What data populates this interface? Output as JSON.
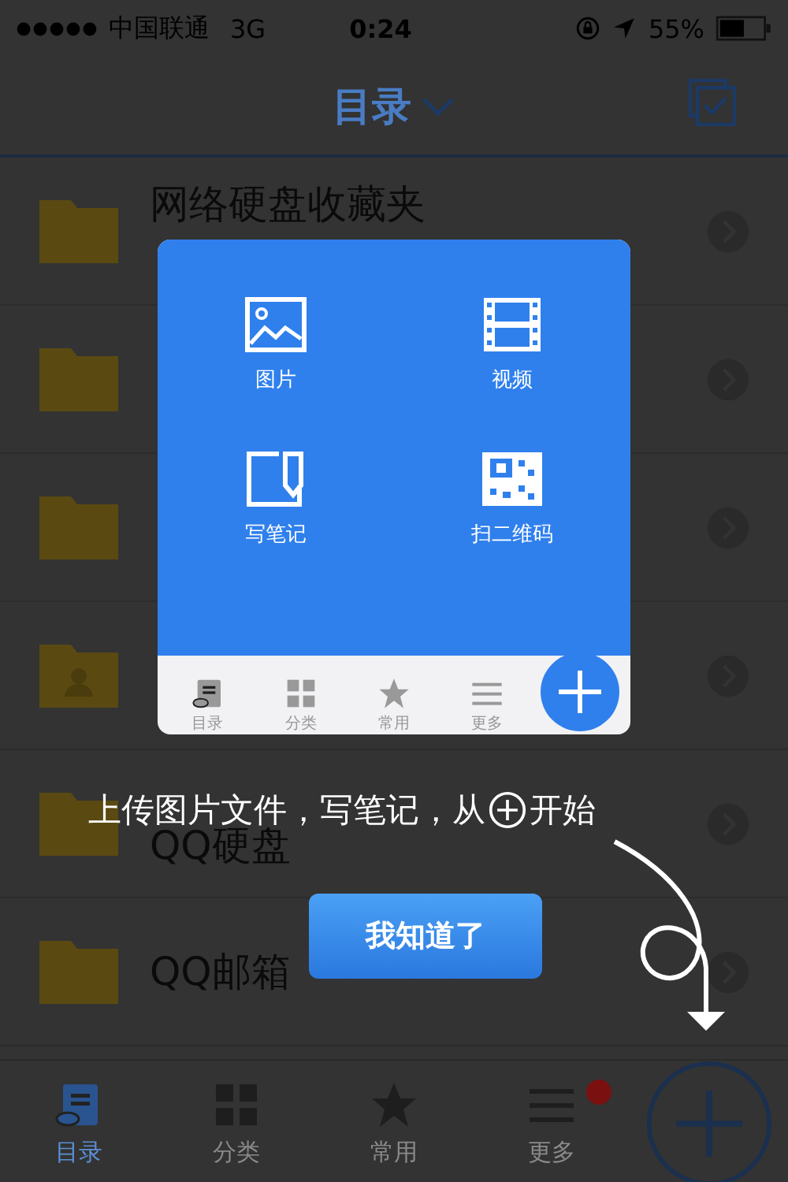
{
  "status_bar": {
    "carrier": "中国联通",
    "network": "3G",
    "time": "0:24",
    "battery": "55%"
  },
  "nav": {
    "title": "目录"
  },
  "folders": [
    {
      "name": "网络硬盘收藏夹",
      "kind": "plain"
    },
    {
      "kind": "plain"
    },
    {
      "kind": "plain"
    },
    {
      "kind": "shared"
    },
    {
      "name": "QQ硬盘",
      "kind": "plain"
    },
    {
      "name": "QQ邮箱",
      "kind": "plain"
    }
  ],
  "tabs": [
    {
      "label": "目录",
      "selected": true,
      "badge": false
    },
    {
      "label": "分类",
      "selected": false,
      "badge": false
    },
    {
      "label": "常用",
      "selected": false,
      "badge": false
    },
    {
      "label": "更多",
      "selected": false,
      "badge": true
    }
  ],
  "popup": {
    "actions": [
      {
        "label": "图片"
      },
      {
        "label": "视频"
      },
      {
        "label": "写笔记"
      },
      {
        "label": "扫二维码"
      }
    ],
    "tabs": [
      {
        "label": "目录"
      },
      {
        "label": "分类"
      },
      {
        "label": "常用"
      },
      {
        "label": "更多"
      }
    ]
  },
  "guide": {
    "before": "上传图片文件，写笔记，从",
    "after": "开始"
  },
  "button": "我知道了"
}
